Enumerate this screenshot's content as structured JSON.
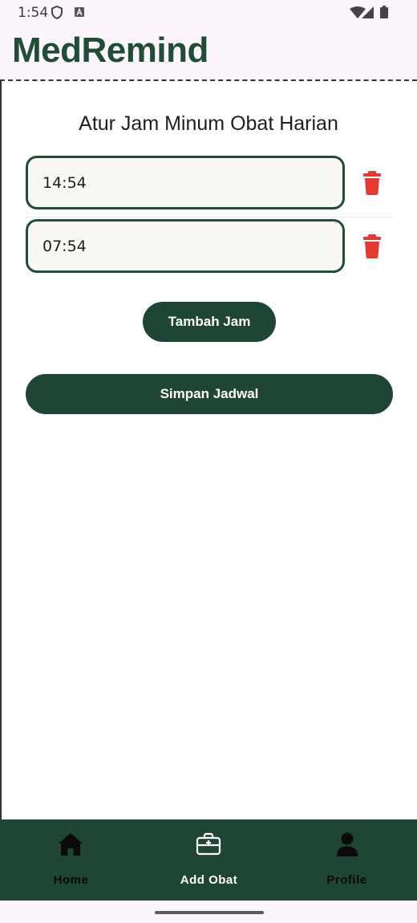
{
  "status_bar": {
    "time": "1:54"
  },
  "header": {
    "title": "MedRemind"
  },
  "schedule": {
    "heading": "Atur Jam Minum Obat Harian",
    "times": [
      {
        "value": "14:54"
      },
      {
        "value": "07:54"
      }
    ],
    "add_button_label": "Tambah Jam",
    "save_button_label": "Simpan Jadwal"
  },
  "bottom_nav": {
    "items": [
      {
        "label": "Home",
        "icon": "home-icon",
        "active": false
      },
      {
        "label": "Add Obat",
        "icon": "medical-kit-icon",
        "active": true
      },
      {
        "label": "Profile",
        "icon": "person-icon",
        "active": false
      }
    ]
  },
  "colors": {
    "primary": "#1f4535",
    "title_green": "#1f4d35",
    "delete_red": "#e53935",
    "header_bg": "#fcf5fb",
    "field_bg": "#faf8f2"
  }
}
